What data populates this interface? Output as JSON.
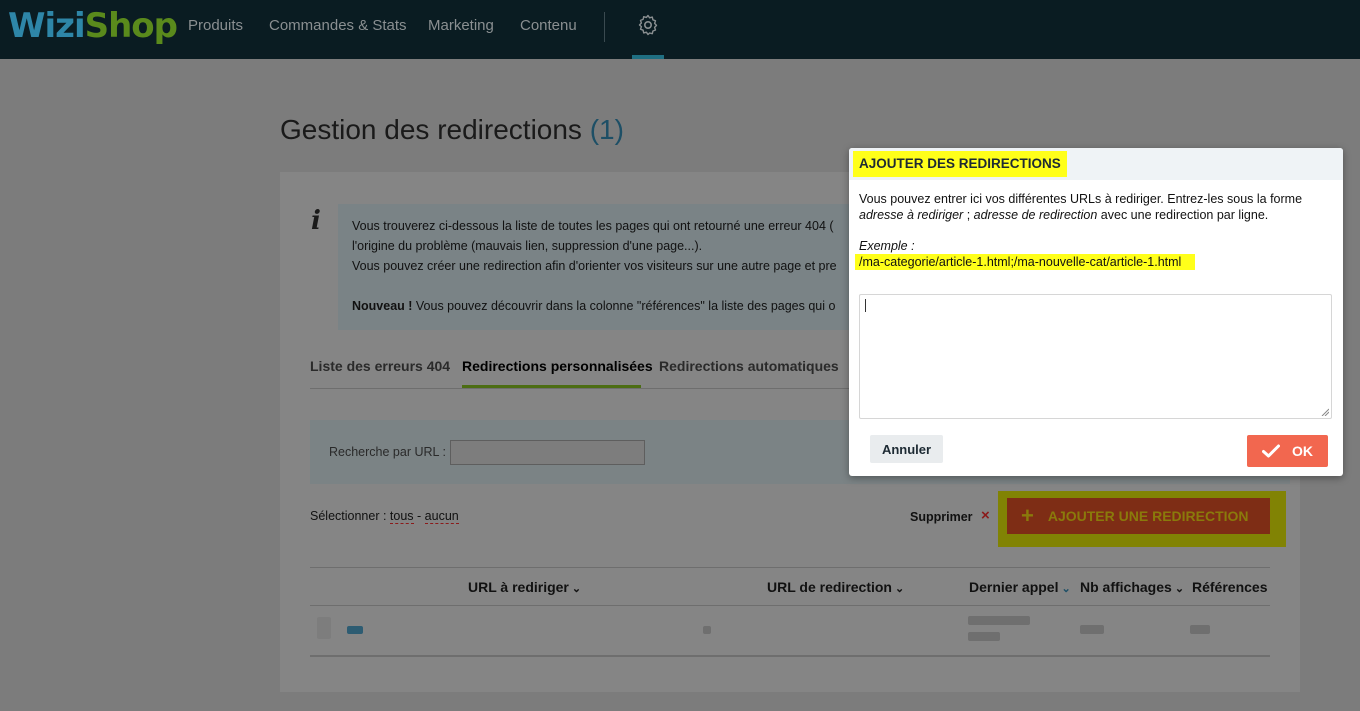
{
  "brand": {
    "logo_part1": "Wizi",
    "logo_part2": "Shop"
  },
  "nav": {
    "items": [
      {
        "label": "Produits"
      },
      {
        "label": "Commandes & Stats"
      },
      {
        "label": "Marketing"
      },
      {
        "label": "Contenu"
      }
    ],
    "settings_icon": "gear-icon"
  },
  "page": {
    "title": "Gestion des redirections",
    "title_count": "(1)"
  },
  "info": {
    "icon": "info-icon",
    "line1": "Vous trouverez ci-dessous la liste de toutes les pages qui ont retourné une erreur 404 (",
    "line2": "l'origine du problème (mauvais lien, suppression d'une page...).",
    "line3": "Vous pouvez créer une redirection afin d'orienter vos visiteurs sur une autre page et pre",
    "line4_bold": "Nouveau !",
    "line4": " Vous pouvez découvrir dans la colonne \"références\" la liste des pages qui o"
  },
  "tabs": [
    {
      "label": "Liste des erreurs 404"
    },
    {
      "label": "Redirections personnalisées"
    },
    {
      "label": "Redirections automatiques"
    }
  ],
  "search": {
    "label": "Recherche par URL :",
    "value": ""
  },
  "selection": {
    "prefix": "Sélectionner : ",
    "all": "tous",
    "sep": " - ",
    "none": "aucun"
  },
  "actions": {
    "delete_label": "Supprimer",
    "delete_icon": "×",
    "add_label": "AJOUTER UNE REDIRECTION",
    "add_icon": "+"
  },
  "table": {
    "columns": [
      {
        "label": "URL à rediriger"
      },
      {
        "label": "URL de redirection"
      },
      {
        "label": "Dernier appel"
      },
      {
        "label": "Nb affichages"
      },
      {
        "label": "Références"
      }
    ]
  },
  "modal": {
    "title": "AJOUTER DES REDIRECTIONS",
    "intro": "Vous pouvez entrer ici vos différentes URLs à rediriger. Entrez-les sous la forme",
    "intro_italic1": "adresse à rediriger",
    "intro_sep": " ; ",
    "intro_italic2": "adresse de redirection",
    "intro_tail": " avec une redirection par ligne.",
    "example_label": "Exemple :",
    "example_value": "/ma-categorie/article-1.html;/ma-nouvelle-cat/article-1.html",
    "textarea_value": "",
    "cancel_label": "Annuler",
    "ok_label": "OK"
  },
  "colors": {
    "topbar": "#0a1c22",
    "highlight": "#ffff1a",
    "ok_button": "#f2674f",
    "tab_active_underline": "#4c6d13"
  }
}
